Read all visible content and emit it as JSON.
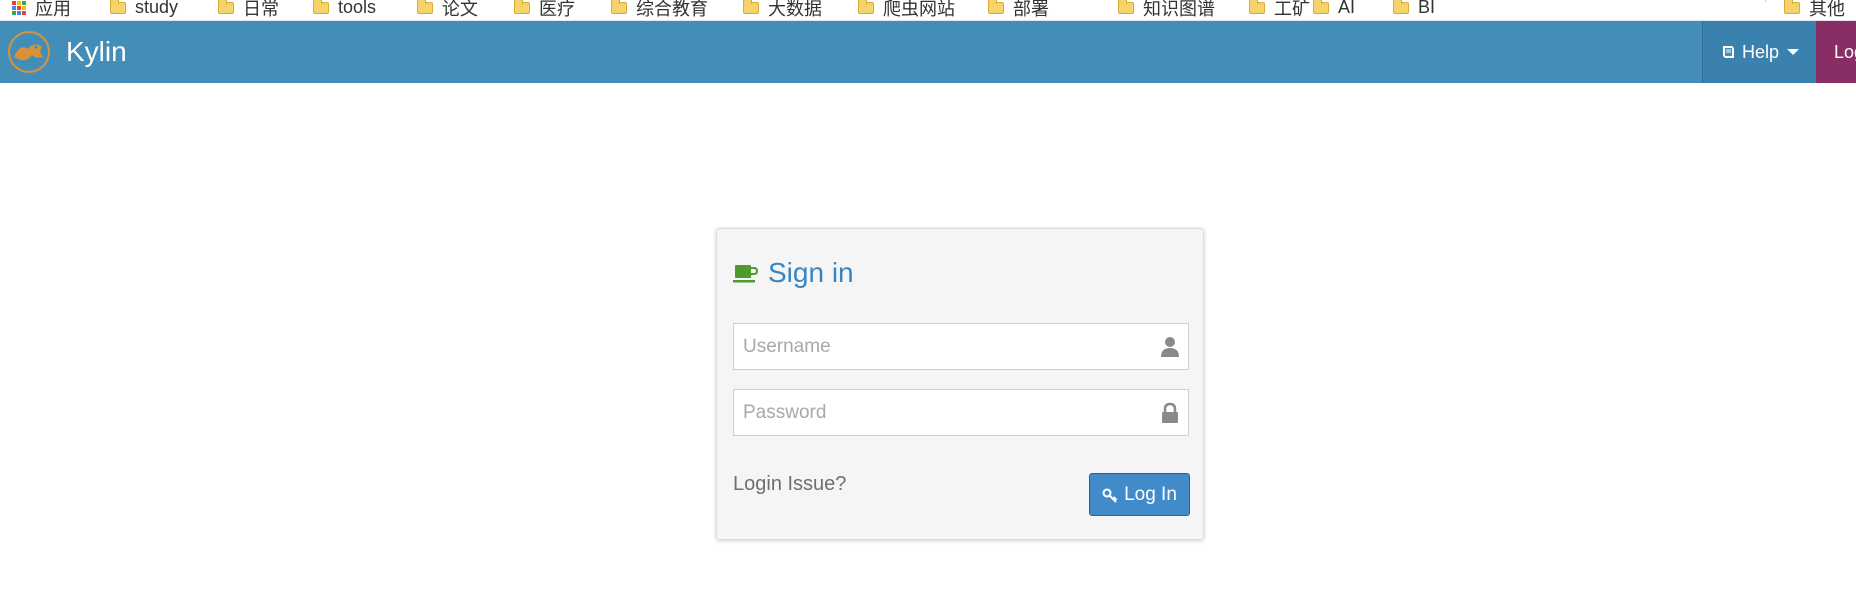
{
  "bookmarks_bar": {
    "items": [
      {
        "label": "应用",
        "icon": "apps-icon"
      },
      {
        "label": "study",
        "icon": "folder-icon"
      },
      {
        "label": "日常",
        "icon": "folder-icon"
      },
      {
        "label": "tools",
        "icon": "folder-icon"
      },
      {
        "label": "论文",
        "icon": "folder-icon"
      },
      {
        "label": "医疗",
        "icon": "folder-icon"
      },
      {
        "label": "综合教育",
        "icon": "folder-icon"
      },
      {
        "label": "大数据",
        "icon": "folder-icon"
      },
      {
        "label": "爬虫网站",
        "icon": "folder-icon"
      },
      {
        "label": "部署",
        "icon": "folder-icon"
      },
      {
        "label": "知识图谱",
        "icon": "folder-icon"
      },
      {
        "label": "工矿",
        "icon": "folder-icon"
      },
      {
        "label": "AI",
        "icon": "folder-icon"
      },
      {
        "label": "BI",
        "icon": "folder-icon"
      }
    ],
    "other_bookmarks": "其他"
  },
  "navbar": {
    "brand": "Kylin",
    "logo_icon": "kylin-logo-icon",
    "help_label": "Help",
    "help_icon": "book-icon",
    "login_label": "Login",
    "bg_color": "#438eb9",
    "login_color": "#892e65"
  },
  "signin": {
    "title": "Sign in",
    "title_icon": "coffee-cup-icon",
    "title_color": "#3a85c0",
    "username_placeholder": "Username",
    "username_icon": "user-icon",
    "password_placeholder": "Password",
    "password_icon": "lock-icon",
    "login_issue": "Login Issue?",
    "login_button": "Log In",
    "login_button_icon": "key-icon",
    "button_color": "#428bca"
  }
}
